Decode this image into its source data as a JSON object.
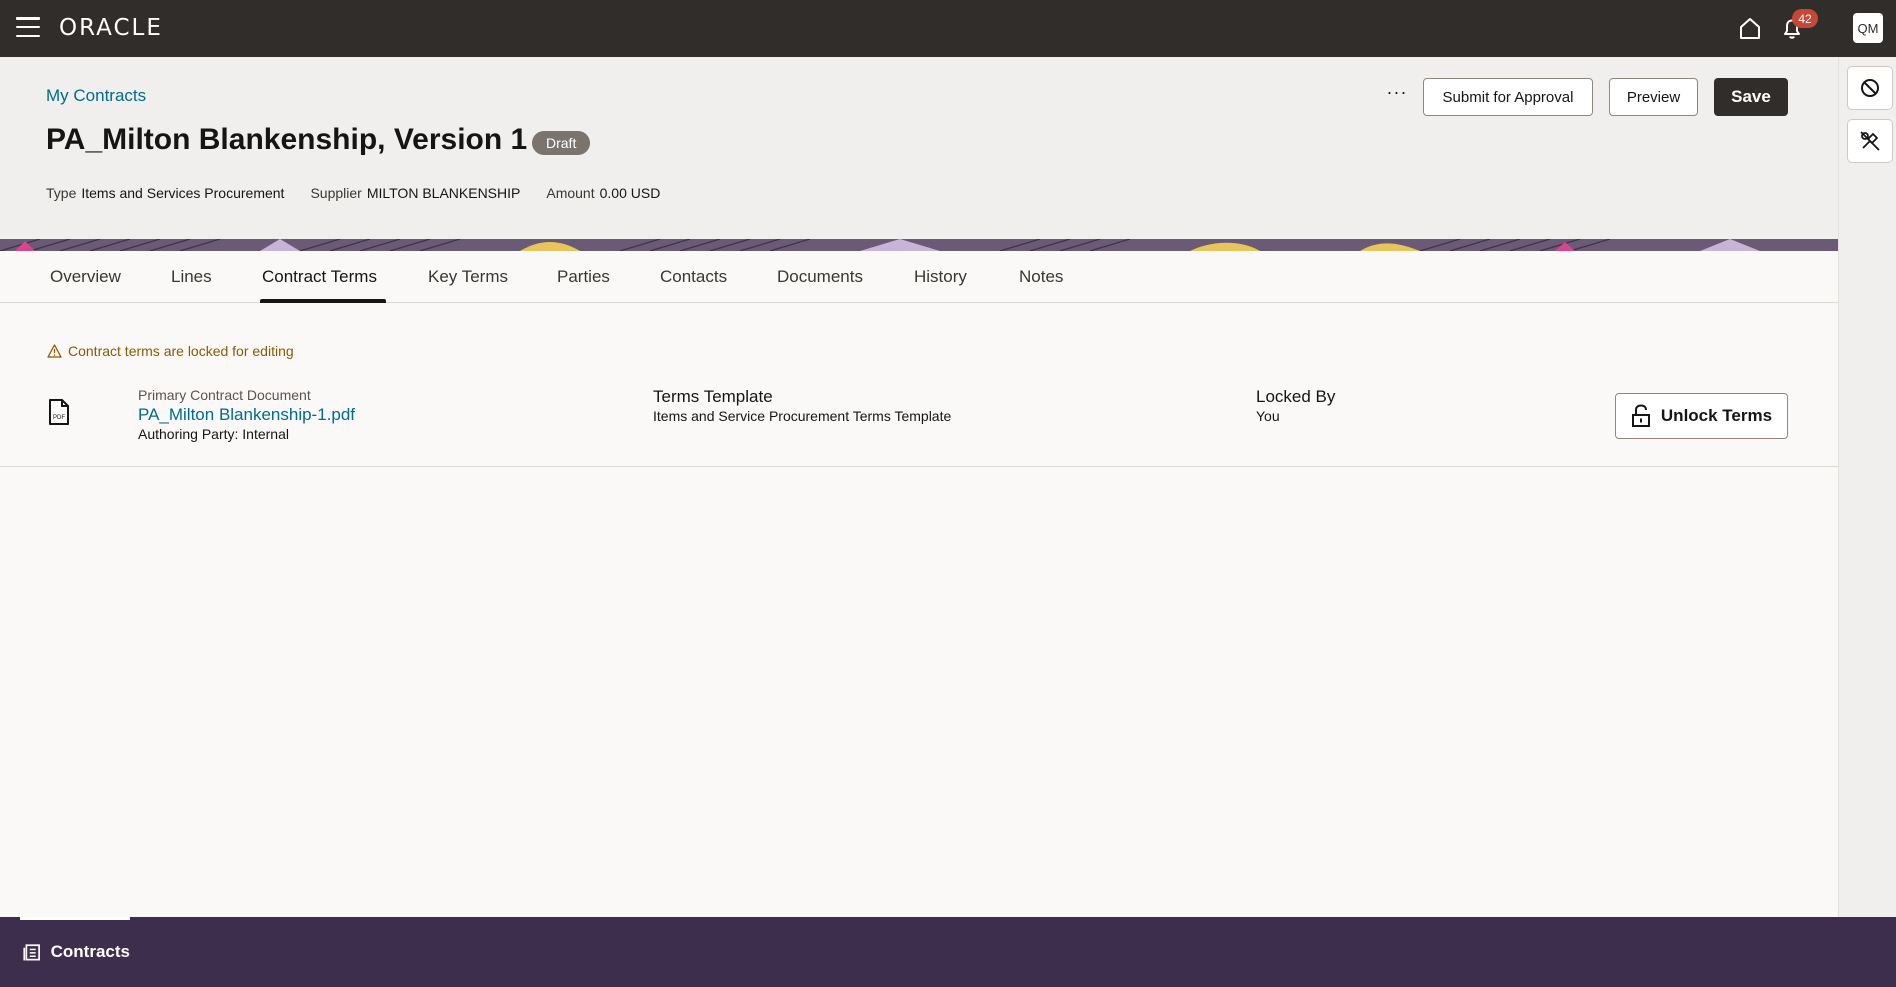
{
  "topbar": {
    "brand": "ORACLE",
    "notifications_count": "42",
    "user_initials": "QM"
  },
  "header": {
    "breadcrumb": "My Contracts",
    "title": "PA_Milton Blankenship, Version 1",
    "status": "Draft",
    "meta": [
      {
        "label": "Type",
        "value": "Items and Services Procurement"
      },
      {
        "label": "Supplier",
        "value": "MILTON BLANKENSHIP"
      },
      {
        "label": "Amount",
        "value": "0.00 USD"
      }
    ],
    "actions": {
      "more": "···",
      "submit": "Submit for Approval",
      "preview": "Preview",
      "save": "Save"
    }
  },
  "tabs": [
    {
      "label": "Overview"
    },
    {
      "label": "Lines"
    },
    {
      "label": "Contract Terms",
      "active": true
    },
    {
      "label": "Key Terms"
    },
    {
      "label": "Parties"
    },
    {
      "label": "Contacts"
    },
    {
      "label": "Documents"
    },
    {
      "label": "History"
    },
    {
      "label": "Notes"
    }
  ],
  "content": {
    "warning": "Contract terms are locked for editing",
    "document": {
      "label": "Primary Contract Document",
      "file": "PA_Milton Blankenship-1.pdf",
      "party": "Authoring Party: Internal",
      "icon_text": "PDF"
    },
    "template": {
      "label": "Terms Template",
      "value": "Items and Service Procurement Terms Template"
    },
    "locked_by": {
      "label": "Locked By",
      "value": "You"
    },
    "unlock_button": "Unlock Terms"
  },
  "footer": {
    "tab": "Contracts"
  },
  "colors": {
    "topbar": "#312d2a",
    "link": "#006b8f",
    "footer": "#3c2e4c",
    "badge": "#c74634",
    "warning": "#8a5a00"
  }
}
